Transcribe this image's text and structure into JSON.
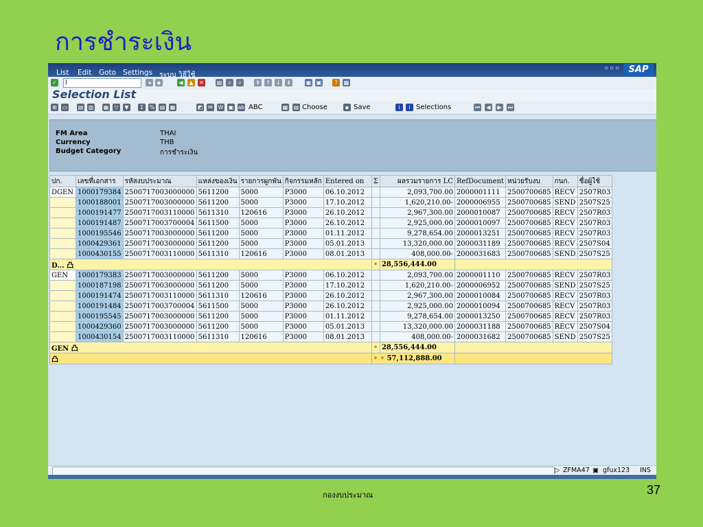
{
  "slide": {
    "title": "การชำระเงิน",
    "footer": "กองงบประมาณ",
    "page": "37"
  },
  "menu": {
    "items": [
      "List",
      "Edit",
      "Goto",
      "Settings",
      "ระบบ",
      "วิธีใช้"
    ],
    "logo": "SAP"
  },
  "command_field": {
    "value": "l"
  },
  "screen_title": "Selection List",
  "toolbar": {
    "abc": "ABC",
    "choose": "Choose",
    "save": "Save",
    "selections": "Selections"
  },
  "header": {
    "fm_area_label": "FM Area",
    "fm_area_value": "THAI",
    "currency_label": "Currency",
    "currency_value": "THB",
    "budget_label": "Budget Category",
    "budget_value": "การชำระเงิน"
  },
  "columns": [
    "ปก.",
    "เลขที่เอกสาร",
    "รหัสงบประมาณ",
    "แหล่งของเงิน",
    "รายการผูกพัน",
    "กิจกรรมหลัก",
    "Entered on",
    "Σ",
    "ผลรวมรายการ LC",
    "RefDocument",
    "หน่วยรับงบ",
    "กนก.",
    "ชื่อผู้ใช้"
  ],
  "groups": [
    {
      "label": "DGEN",
      "rows": [
        [
          "1000179384",
          "2500717003000000",
          "5611200",
          "5000",
          "P3000",
          "06.10.2012",
          "2,093,700.00",
          "2000001111",
          "2500700685",
          "RECV",
          "2507R03"
        ],
        [
          "1000188001",
          "2500717003000000",
          "5611200",
          "5000",
          "P3000",
          "17.10.2012",
          "1,620,210.00-",
          "2000006955",
          "2500700685",
          "SEND",
          "2507S25"
        ],
        [
          "1000191477",
          "2500717003110000",
          "5611310",
          "120616",
          "P3000",
          "26.10.2012",
          "2,967,300.00",
          "2000010087",
          "2500700685",
          "RECV",
          "2507R03"
        ],
        [
          "1000191487",
          "2500717003700004",
          "5611500",
          "5000",
          "P3000",
          "26.10.2012",
          "2,925,000.00",
          "2000010097",
          "2500700685",
          "RECV",
          "2507R03"
        ],
        [
          "1000195546",
          "2500717003000000",
          "5611200",
          "5000",
          "P3000",
          "01.11.2012",
          "9,278,654.00",
          "2000013251",
          "2500700685",
          "RECV",
          "2507R03"
        ],
        [
          "1000429361",
          "2500717003000000",
          "5611200",
          "5000",
          "P3000",
          "05.01.2013",
          "13,320,000.00",
          "2000031189",
          "2500700685",
          "RECV",
          "2507S04"
        ],
        [
          "1000430155",
          "2500717003110000",
          "5611310",
          "120616",
          "P3000",
          "08.01.2013",
          "408,000.00-",
          "2000031683",
          "2500700685",
          "SEND",
          "2507S25"
        ]
      ],
      "subtotal_label": "D... 凸",
      "subtotal_marker": "•",
      "subtotal": "28,556,444.00"
    },
    {
      "label": "GEN",
      "rows": [
        [
          "1000179383",
          "2500717003000000",
          "5611200",
          "5000",
          "P3000",
          "06.10.2012",
          "2,093,700.00",
          "2000001110",
          "2500700685",
          "RECV",
          "2507R03"
        ],
        [
          "1000187198",
          "2500717003000000",
          "5611200",
          "5000",
          "P3000",
          "17.10.2012",
          "1,620,210.00-",
          "2000006952",
          "2500700685",
          "SEND",
          "2507S25"
        ],
        [
          "1000191474",
          "2500717003110000",
          "5611310",
          "120616",
          "P3000",
          "26.10.2012",
          "2,967,300.00",
          "2000010084",
          "2500700685",
          "RECV",
          "2507R03"
        ],
        [
          "1000191484",
          "2500717003700004",
          "5611500",
          "5000",
          "P3000",
          "26.10.2012",
          "2,925,000.00",
          "2000010094",
          "2500700685",
          "RECV",
          "2507R03"
        ],
        [
          "1000195545",
          "2500717003000000",
          "5611200",
          "5000",
          "P3000",
          "01.11.2012",
          "9,278,654.00",
          "2000013250",
          "2500700685",
          "RECV",
          "2507R03"
        ],
        [
          "1000429360",
          "2500717003000000",
          "5611200",
          "5000",
          "P3000",
          "05.01.2013",
          "13,320,000.00",
          "2000031188",
          "2500700685",
          "RECV",
          "2507S04"
        ],
        [
          "1000430154",
          "2500717003110000",
          "5611310",
          "120616",
          "P3000",
          "08.01.2013",
          "408,000.00-",
          "2000031682",
          "2500700685",
          "SEND",
          "2507S25"
        ]
      ],
      "subtotal_label": "GEN 凸",
      "subtotal_marker": "•",
      "subtotal": "28,556,444.00"
    }
  ],
  "grand_total": {
    "label": "凸",
    "marker": "• •",
    "value": "57,112,888.00"
  },
  "status": {
    "transaction": "ZFMA47",
    "user": "gfux123",
    "mode": "INS"
  }
}
